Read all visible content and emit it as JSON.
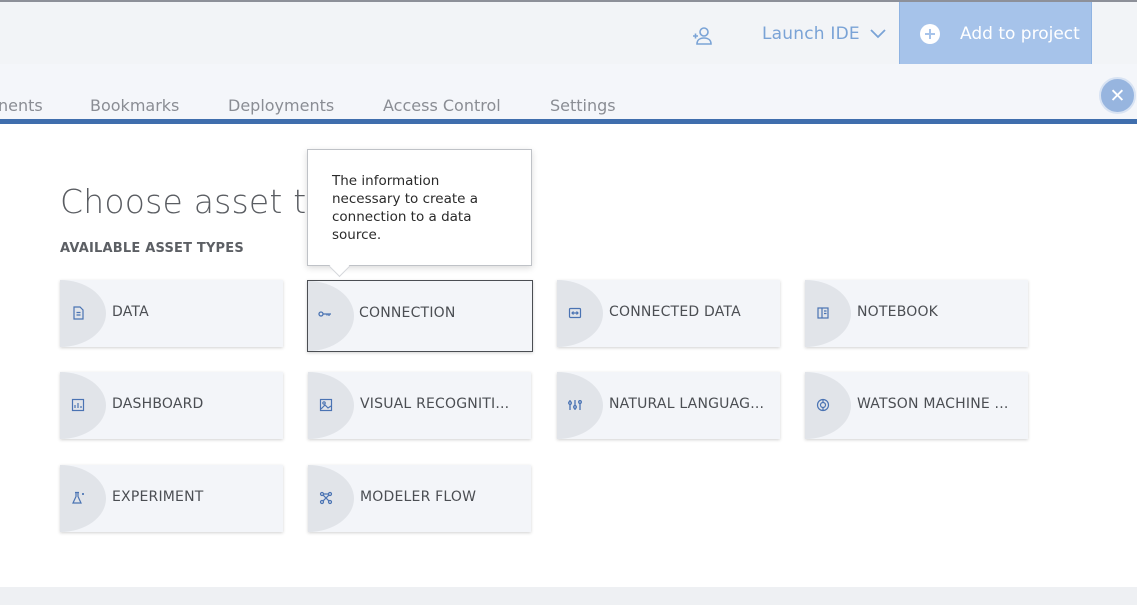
{
  "header": {
    "launch_ide": "Launch IDE",
    "add_to_project": "Add to project"
  },
  "tabs": [
    {
      "label": "nents"
    },
    {
      "label": "Bookmarks"
    },
    {
      "label": "Deployments"
    },
    {
      "label": "Access Control"
    },
    {
      "label": "Settings"
    }
  ],
  "panel": {
    "title": "Choose asset ty",
    "section_label": "AVAILABLE ASSET TYPES",
    "tooltip": "The information necessary to create a connection to a data source."
  },
  "assets": [
    {
      "label": "DATA",
      "icon": "data-icon"
    },
    {
      "label": "CONNECTION",
      "icon": "connection-icon"
    },
    {
      "label": "CONNECTED DATA",
      "icon": "connected-data-icon"
    },
    {
      "label": "NOTEBOOK",
      "icon": "notebook-icon"
    },
    {
      "label": "DASHBOARD",
      "icon": "dashboard-icon"
    },
    {
      "label": "VISUAL RECOGNITI...",
      "icon": "visual-recognition-icon"
    },
    {
      "label": "NATURAL LANGUAG...",
      "icon": "natural-language-icon"
    },
    {
      "label": "WATSON MACHINE ...",
      "icon": "watson-machine-icon"
    },
    {
      "label": "EXPERIMENT",
      "icon": "experiment-icon"
    },
    {
      "label": "MODELER FLOW",
      "icon": "modeler-flow-icon"
    }
  ],
  "colors": {
    "accent": "#3f6ead",
    "primary_button": "#a6c3ea"
  }
}
